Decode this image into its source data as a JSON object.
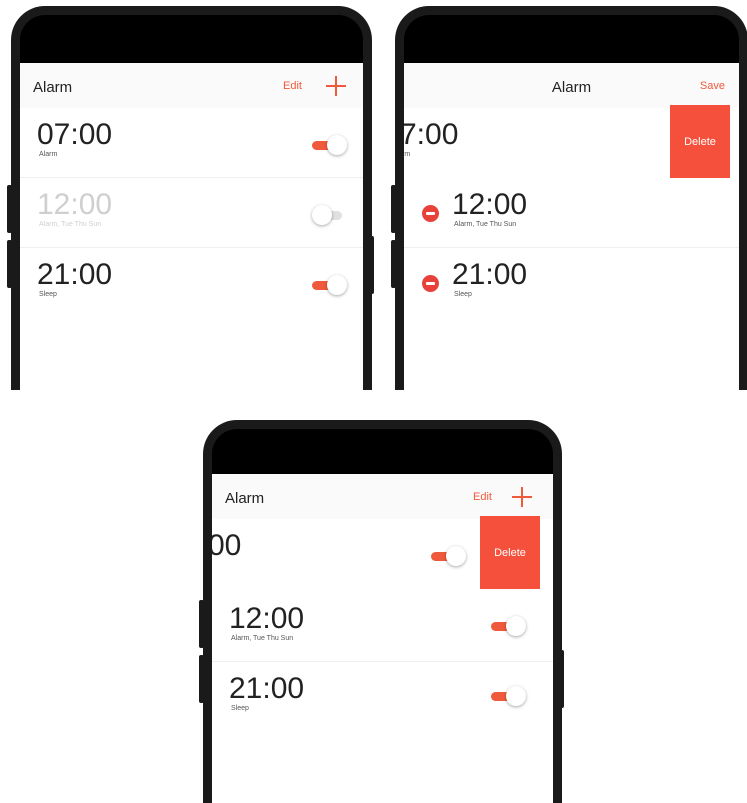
{
  "colors": {
    "accent": "#f05a3c",
    "delete_background": "#f5503c",
    "remove_icon": "#e8413a",
    "toggle_off": "#e0e0e0",
    "phone_frame": "#1a1a1a"
  },
  "panel_normal": {
    "header": {
      "title": "Alarm",
      "edit_label": "Edit",
      "add_icon": "plus-icon"
    },
    "alarms": [
      {
        "time": "07:00",
        "label": "Alarm",
        "enabled": true
      },
      {
        "time": "12:00",
        "label": "Alarm, Tue Thu Sun",
        "enabled": false
      },
      {
        "time": "21:00",
        "label": "Sleep",
        "enabled": true
      }
    ]
  },
  "panel_edit": {
    "header": {
      "title": "Alarm",
      "save_label": "Save"
    },
    "swiped_row": {
      "time_visible": "7:00",
      "label_visible": "rm",
      "delete_label": "Delete"
    },
    "alarms": [
      {
        "time": "12:00",
        "label": "Alarm, Tue Thu Sun",
        "remove_icon": "minus-circle-icon"
      },
      {
        "time": "21:00",
        "label": "Sleep",
        "remove_icon": "minus-circle-icon"
      }
    ]
  },
  "panel_swipe": {
    "header": {
      "title": "Alarm",
      "edit_label": "Edit",
      "add_icon": "plus-icon"
    },
    "swiped_row": {
      "time_visible": "00",
      "enabled": true,
      "delete_label": "Delete"
    },
    "alarms": [
      {
        "time": "12:00",
        "label": "Alarm, Tue Thu Sun",
        "enabled": true
      },
      {
        "time": "21:00",
        "label": "Sleep",
        "enabled": true
      }
    ]
  }
}
